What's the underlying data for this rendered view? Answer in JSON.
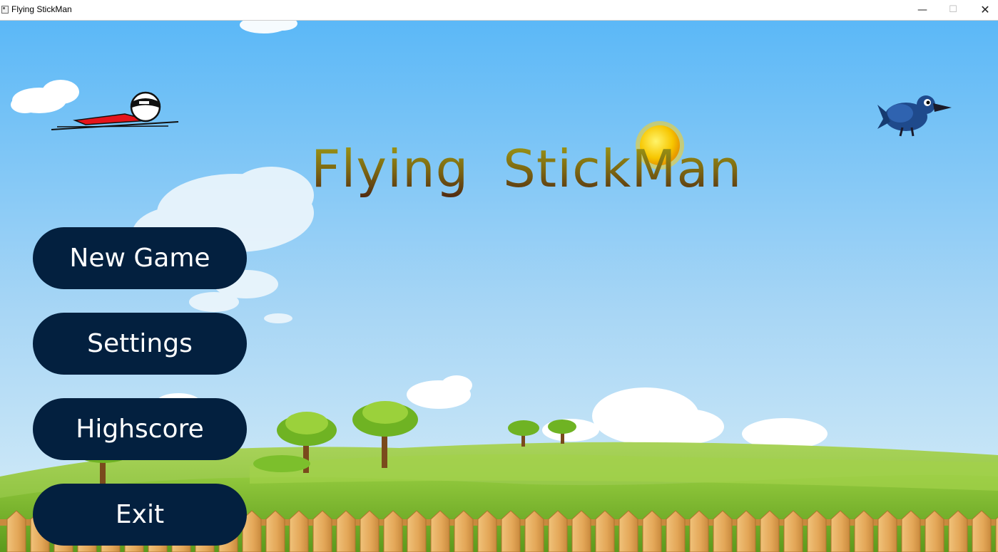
{
  "window": {
    "title": "Flying StickMan",
    "controls": {
      "minimize": "—",
      "maximize": "☐",
      "close": "✕"
    }
  },
  "game": {
    "title": "Flying  StickMan"
  },
  "menu": {
    "new_game": "New Game",
    "settings": "Settings",
    "highscore": "Highscore",
    "exit": "Exit"
  },
  "colors": {
    "button_bg": "#03203f",
    "button_text": "#ffffff",
    "sky_top": "#5bb8f7",
    "sky_bottom": "#cfe7f7",
    "grass": "#8cc63c",
    "fence": "#e8b25f"
  },
  "sprites": [
    "stickman-glider-icon",
    "crow-icon",
    "sun-icon"
  ]
}
